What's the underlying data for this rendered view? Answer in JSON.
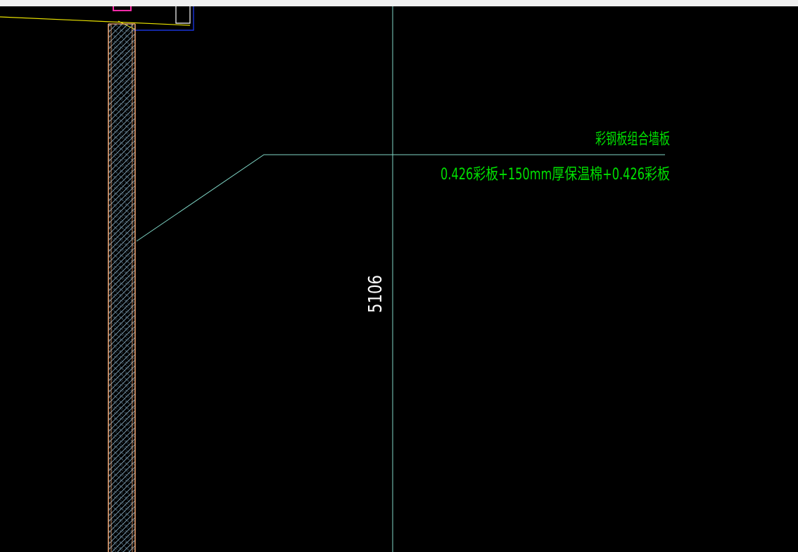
{
  "drawing": {
    "background": "#000000",
    "annotation": {
      "title": "彩钢板组合墙板",
      "spec": "0.426彩板+150mm厚保温棉+0.426彩板",
      "color": "#00e000"
    },
    "dimension": {
      "value": "5106",
      "color": "#ffffff"
    },
    "colors": {
      "grid_line": "#7fd6c6",
      "leader": "#7fd6c6",
      "wall_outline": "#f3a774",
      "wall_hatch": "#8cb0c6",
      "beam_edge_yellow": "#e9e200",
      "beam_edge_white": "#ffffff",
      "beam_edge_blue": "#1f3dff",
      "channel_magenta": "#ff2aa8"
    }
  }
}
